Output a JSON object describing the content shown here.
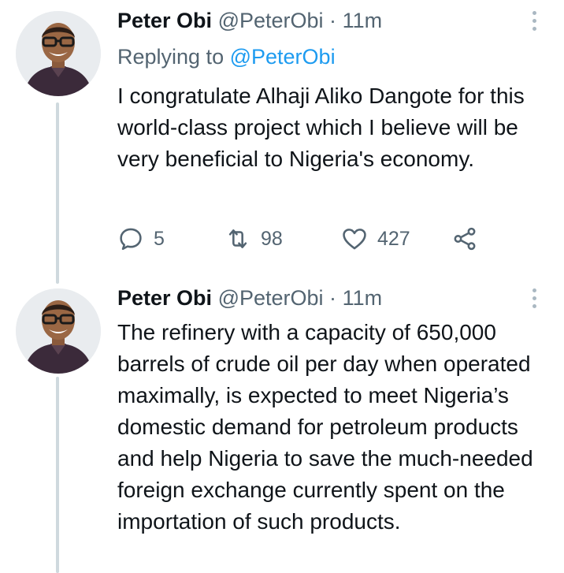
{
  "tweets": [
    {
      "author_name": "Peter Obi",
      "handle": "@PeterObi",
      "separator": "·",
      "time": "11m",
      "replying_to_prefix": "Replying to",
      "replying_to_handle": "@PeterObi",
      "text": "I congratulate Alhaji Aliko Dangote for this world-class project which I believe will be very beneficial to Nigeria's economy.",
      "replies": "5",
      "retweets": "98",
      "likes": "427",
      "avatar_icon": "profile-photo"
    },
    {
      "author_name": "Peter Obi",
      "handle": "@PeterObi",
      "separator": "·",
      "time": "11m",
      "text": "The refinery with a capacity of 650,000 barrels of crude oil per day when operated maximally, is expected to meet Nigeria’s domestic demand for petroleum products and help Nigeria to save the much-needed foreign exchange currently spent on the importation of such products.",
      "avatar_icon": "profile-photo"
    }
  ],
  "colors": {
    "text_primary": "#0f1419",
    "text_secondary": "#536471",
    "link": "#1d9bf0",
    "thread_line": "#cfd9de"
  }
}
